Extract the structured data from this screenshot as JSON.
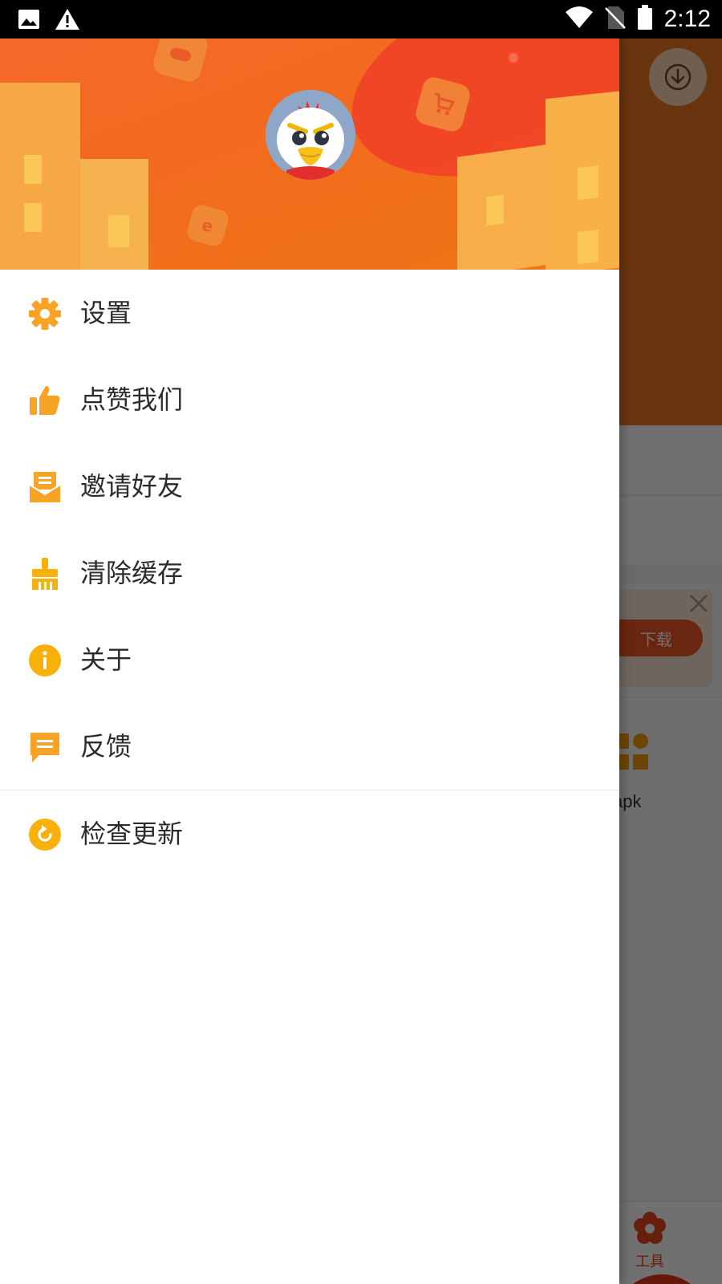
{
  "status_bar": {
    "time": "2:12",
    "icons_left": [
      "image-icon",
      "warning-icon"
    ],
    "icons_right": [
      "wifi-icon",
      "no-sim-icon",
      "battery-icon"
    ]
  },
  "background_app": {
    "download_button_label": "下载",
    "tool_label": "apk",
    "bottom_tab_label": "工具"
  },
  "drawer": {
    "menu_items": [
      {
        "label": "设置",
        "icon": "gear-icon"
      },
      {
        "label": "点赞我们",
        "icon": "thumbs-up-icon"
      },
      {
        "label": "邀请好友",
        "icon": "mail-icon"
      },
      {
        "label": "清除缓存",
        "icon": "broom-icon"
      },
      {
        "label": "关于",
        "icon": "info-icon"
      },
      {
        "label": "反馈",
        "icon": "feedback-icon"
      }
    ],
    "footer_item": {
      "label": "检查更新",
      "icon": "refresh-icon"
    }
  },
  "colors": {
    "accent": "#f7a325",
    "header_orange": "#f2701f",
    "header_red": "#ef3a28",
    "text": "#2b2b2b",
    "status_bar_bg": "#000000"
  }
}
